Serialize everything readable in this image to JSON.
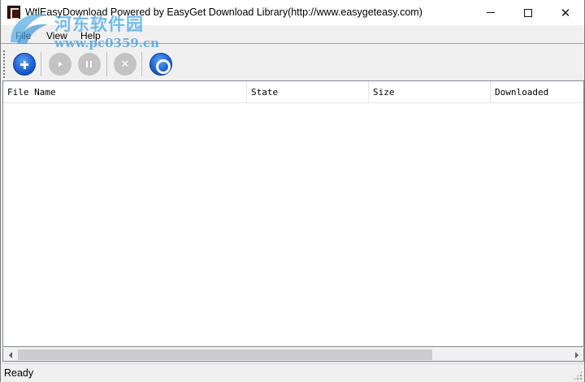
{
  "window": {
    "title": "WtlEasyDownload Powered by EasyGet Download Library(http://www.easygeteasy.com)"
  },
  "watermark": {
    "site_name": "河东软件园",
    "site_url": "www.pc0359.cn"
  },
  "menu": {
    "items": [
      {
        "label": "File"
      },
      {
        "label": "View"
      },
      {
        "label": "Help"
      }
    ]
  },
  "toolbar": {
    "buttons": [
      {
        "icon": "add-icon",
        "enabled": true
      },
      {
        "icon": "play-icon",
        "enabled": false
      },
      {
        "icon": "pause-icon",
        "enabled": false
      },
      {
        "icon": "stop-icon",
        "enabled": false,
        "glyph": "✕"
      },
      {
        "icon": "settings-icon",
        "enabled": true
      }
    ]
  },
  "list": {
    "columns": [
      {
        "label": "File Name"
      },
      {
        "label": "State"
      },
      {
        "label": "Size"
      },
      {
        "label": "Downloaded"
      }
    ],
    "rows": []
  },
  "status": {
    "text": "Ready"
  },
  "colors": {
    "accent_blue": "#1c63d6",
    "disabled_gray": "#c3c3c3",
    "watermark_blue": "#5bb0e6"
  }
}
